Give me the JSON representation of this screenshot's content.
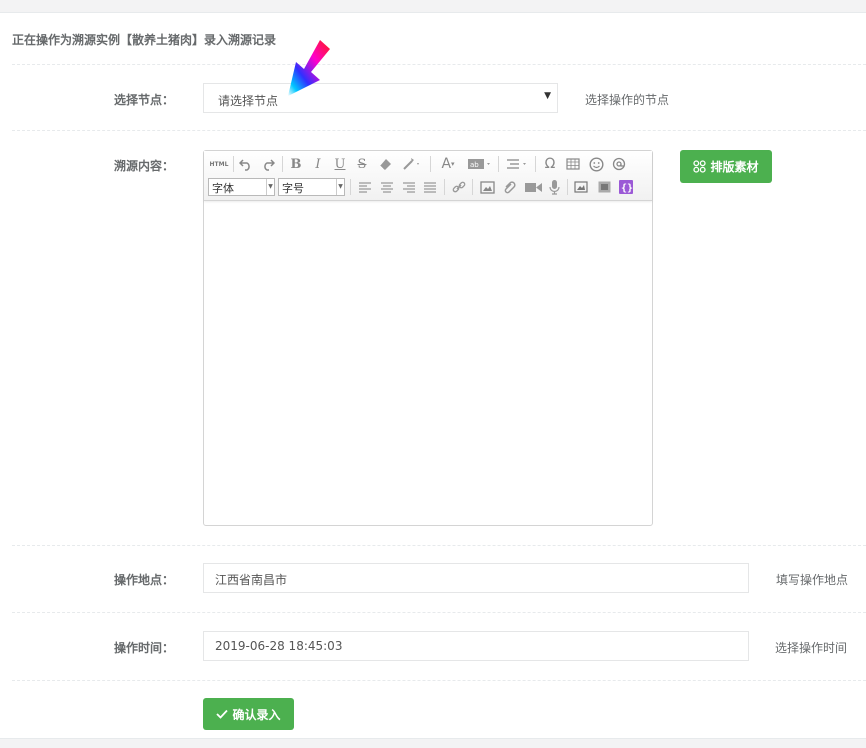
{
  "page": {
    "title": "正在操作为溯源实例【散养土猪肉】录入溯源记录"
  },
  "form": {
    "node": {
      "label": "选择节点：",
      "selected": "请选择节点",
      "help": "选择操作的节点"
    },
    "content": {
      "label": "溯源内容：",
      "layout_button": "排版素材",
      "font_family": "字体",
      "font_size": "字号",
      "html_label": "HTML"
    },
    "location": {
      "label": "操作地点：",
      "value": "江西省南昌市",
      "help": "填写操作地点"
    },
    "time": {
      "label": "操作时间：",
      "value": "2019-06-28 18:45:03",
      "help": "选择操作时间"
    },
    "submit_label": "确认录入"
  },
  "colors": {
    "primary_green": "#4cb04f",
    "label_text": "#676a6c",
    "border": "#e5e6e7"
  }
}
